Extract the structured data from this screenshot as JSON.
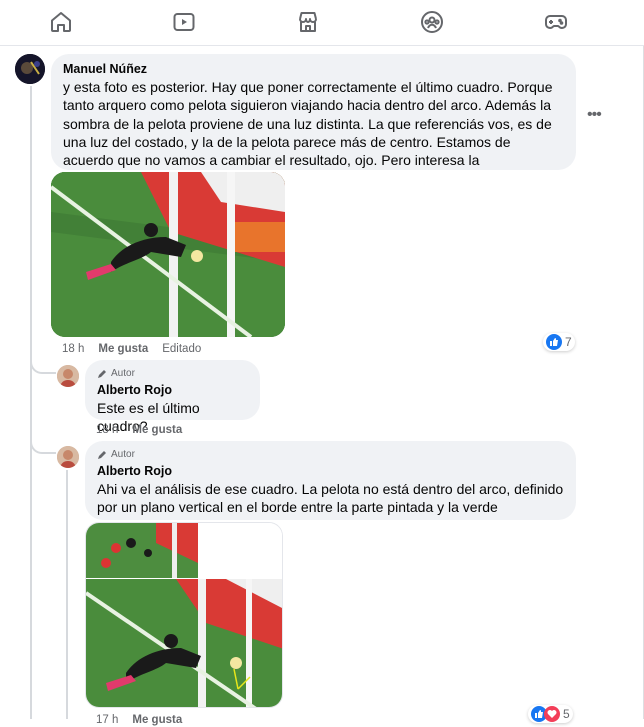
{
  "nav": {
    "icons": [
      "home-icon",
      "video-icon",
      "marketplace-icon",
      "groups-icon",
      "gaming-icon"
    ]
  },
  "comment1": {
    "author": "Manuel Núñez",
    "text": "y esta foto es posterior. Hay que poner correctamente el último cuadro. Porque tanto arquero como pelota siguieron viajando hacia dentro del arco. Además la sombra de la pelota proviene de una luz distinta. La que referenciás vos, es de una luz del costado, y la de la pelota parece más de centro. Estamos de acuerdo que no vamos a cambiar el resultado, ojo. Pero interesa la interpretación",
    "time": "18 h",
    "like_label": "Me gusta",
    "edited_label": "Editado",
    "reaction_count": "7"
  },
  "reply1": {
    "badge": "Autor",
    "author": "Alberto Rojo",
    "text": "Este es el último cuadro?",
    "time": "18 h",
    "like_label": "Me gusta"
  },
  "reply2": {
    "badge": "Autor",
    "author": "Alberto Rojo",
    "text": "Ahi va el análisis de ese cuadro. La pelota no está dentro del arco, definido por un plano vertical en el borde entre la parte pintada y la verde",
    "time": "17 h",
    "like_label": "Me gusta",
    "reaction_count": "5"
  },
  "colors": {
    "bubble": "#f0f2f5",
    "secondary_text": "#65676b",
    "like_blue": "#1877f2",
    "love_red": "#f33e58"
  }
}
